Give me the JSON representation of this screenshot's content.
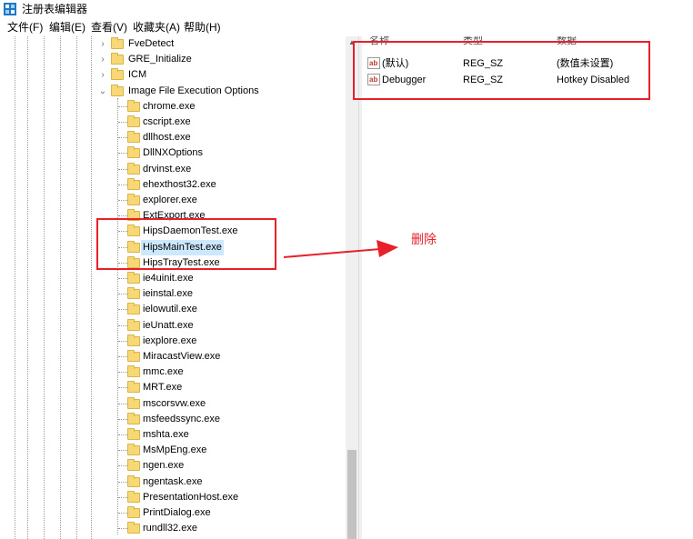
{
  "window": {
    "title": "注册表编辑器"
  },
  "menu": {
    "items": [
      {
        "label": "文件(F)"
      },
      {
        "label": "编辑(E)"
      },
      {
        "label": "查看(V)"
      },
      {
        "label": "收藏夹(A)"
      },
      {
        "label": "帮助(H)"
      }
    ]
  },
  "tree": {
    "parents": [
      {
        "label": "FveDetect",
        "expander": "collapsed"
      },
      {
        "label": "GRE_Initialize",
        "expander": "collapsed"
      },
      {
        "label": "ICM",
        "expander": "collapsed"
      },
      {
        "label": "Image File Execution Options",
        "expander": "expanded"
      }
    ],
    "children": [
      "chrome.exe",
      "cscript.exe",
      "dllhost.exe",
      "DllNXOptions",
      "drvinst.exe",
      "ehexthost32.exe",
      "explorer.exe",
      "ExtExport.exe",
      "HipsDaemonTest.exe",
      "HipsMainTest.exe",
      "HipsTrayTest.exe",
      "ie4uinit.exe",
      "ieinstal.exe",
      "ielowutil.exe",
      "ieUnatt.exe",
      "iexplore.exe",
      "MiracastView.exe",
      "mmc.exe",
      "MRT.exe",
      "mscorsvw.exe",
      "msfeedssync.exe",
      "mshta.exe",
      "MsMpEng.exe",
      "ngen.exe",
      "ngentask.exe",
      "PresentationHost.exe",
      "PrintDialog.exe",
      "rundll32.exe"
    ],
    "selected_index": 9
  },
  "values": {
    "headers": {
      "name": "名称",
      "type": "类型",
      "data": "数据"
    },
    "rows": [
      {
        "name": "(默认)",
        "type": "REG_SZ",
        "data": "(数值未设置)"
      },
      {
        "name": "Debugger",
        "type": "REG_SZ",
        "data": "Hotkey Disabled"
      }
    ]
  },
  "annotation": {
    "text": "删除",
    "color": "#e8202a"
  }
}
